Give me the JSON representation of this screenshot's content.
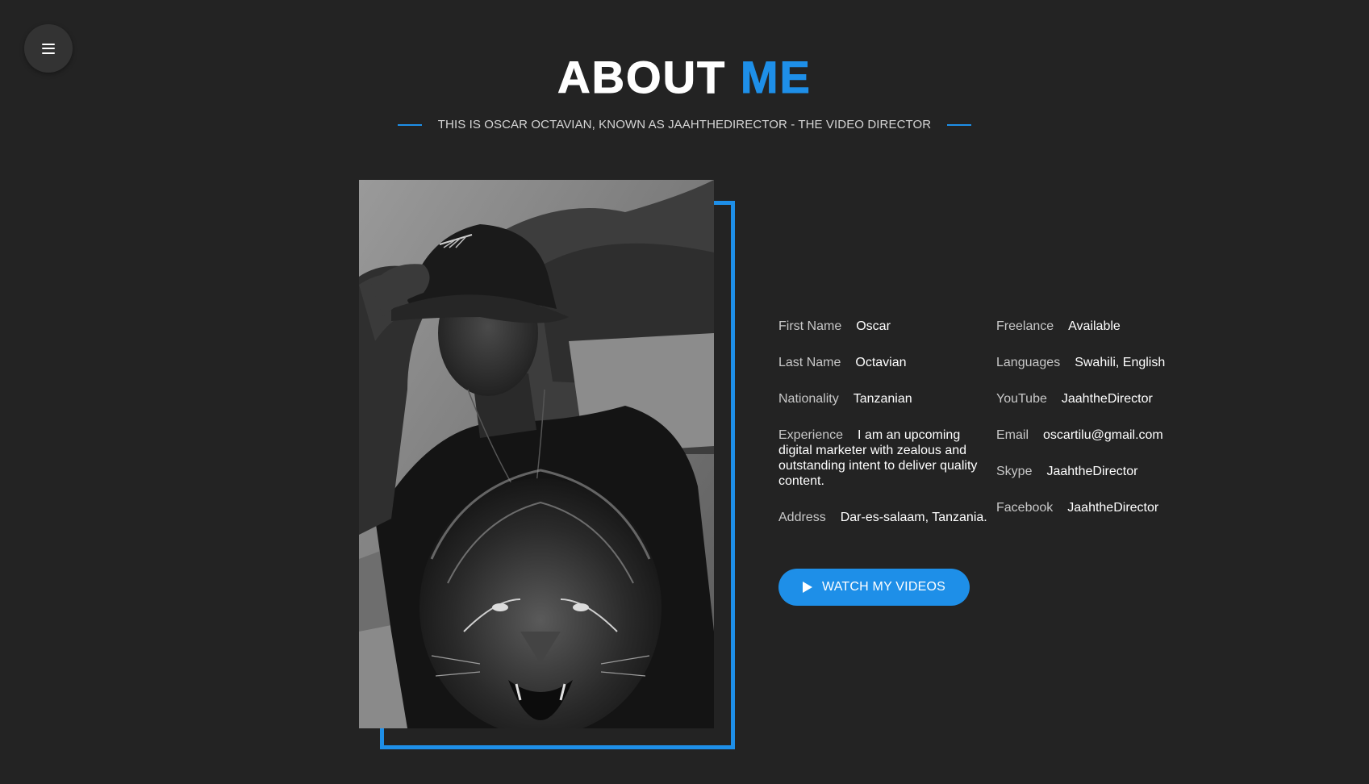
{
  "menu": {
    "icon": "hamburger-icon"
  },
  "header": {
    "title_part1": "ABOUT",
    "title_part2": "ME",
    "subtitle": "THIS IS OSCAR OCTAVIAN, KNOWN AS JAAHTHEDIRECTOR - THE VIDEO DIRECTOR"
  },
  "profile": {
    "photo": "portrait-photo"
  },
  "info_left": [
    {
      "label": "First Name",
      "value": "Oscar"
    },
    {
      "label": "Last Name",
      "value": "Octavian"
    },
    {
      "label": "Nationality",
      "value": "Tanzanian"
    },
    {
      "label": "Experience",
      "value": "I am an upcoming digital marketer with zealous and outstanding intent to deliver quality content."
    },
    {
      "label": "Address",
      "value": "Dar-es-salaam, Tanzania."
    }
  ],
  "info_right": [
    {
      "label": "Freelance",
      "value": "Available"
    },
    {
      "label": "Languages",
      "value": "Swahili, English"
    },
    {
      "label": "YouTube",
      "value": "JaahtheDirector"
    },
    {
      "label": "Email",
      "value": "oscartilu@gmail.com"
    },
    {
      "label": "Skype",
      "value": "JaahtheDirector"
    },
    {
      "label": "Facebook",
      "value": "JaahtheDirector"
    }
  ],
  "cta": {
    "label": "WATCH MY VIDEOS",
    "icon": "play-icon"
  },
  "colors": {
    "background": "#232323",
    "accent": "#1e8fe8",
    "menu_bg": "#333333"
  }
}
